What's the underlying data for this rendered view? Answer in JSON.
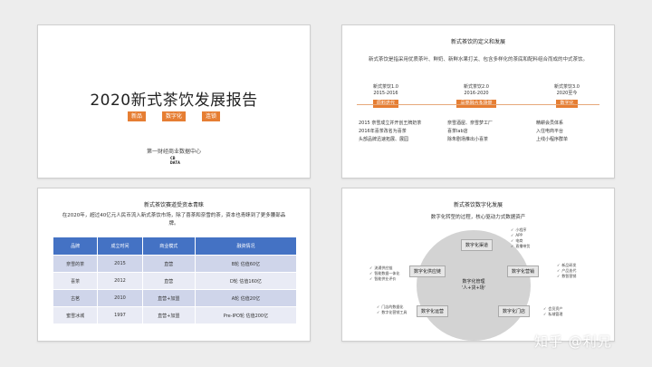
{
  "slide1": {
    "title": "2020新式茶饮发展报告",
    "tags": [
      "新品",
      "数字化",
      "连锁"
    ],
    "subtitle": "第一财经商业数据中心",
    "logo_lines": [
      "CB",
      "DATA"
    ]
  },
  "slide2": {
    "title": "新式茶饮的定义和发展",
    "desc": "新式茶饮是指采用优质茶叶、鲜奶、新鲜水果打关、包含多样化的茶底和配料组合而成的中式茶饮。",
    "versions": [
      {
        "label": "新式茶饮1.0",
        "years": "2015-2016",
        "box": "原料迭代"
      },
      {
        "label": "新式茶饮2.0",
        "years": "2016-2020",
        "box": "品类融合多场景"
      },
      {
        "label": "新式茶饮3.0",
        "years": "2020至今",
        "box": "数字化"
      }
    ],
    "features": [
      [
        "2015 奈雪成立并开创王牌奶茶",
        "2016年喜茶改名为喜茶",
        "头部品牌迅速拓展、展园"
      ],
      [
        "奈雪酒屋、奈雪梦工厂",
        "喜茶lab店",
        "除朱剧场推出小喜茶"
      ],
      [
        "精耕会员体系",
        "入住电商平台",
        "上线小程序群单"
      ]
    ]
  },
  "slide3": {
    "title": "新式茶饮赛道受资本青睐",
    "desc": "在2020年，超过40亿元人民币流入新式茶饮市场，除了喜茶和奈雪的茶，资本也青睐到了更多腰部品牌。",
    "headers": [
      "品牌",
      "成立时间",
      "商业模式",
      "融资情况"
    ],
    "rows": [
      [
        "奈雪的茶",
        "2015",
        "直营",
        "B轮 估值60亿"
      ],
      [
        "喜茶",
        "2012",
        "直营",
        "D轮 估值160亿"
      ],
      [
        "古茗",
        "2010",
        "直营+加盟",
        "A轮 估值20亿"
      ],
      [
        "蜜雪冰城",
        "1997",
        "直营+加盟",
        "Pre-IPO轮 估值200亿"
      ]
    ]
  },
  "slide4": {
    "title": "新式茶饮数字化发展",
    "subtitle": "数字化转型的过程，核心驱动力式数据资产",
    "center": [
      "数字化管理",
      "'人+货+场'"
    ],
    "nodes": {
      "top": "数字化渠道",
      "left": "数字化供应链",
      "right": "数字化营销",
      "bottom_left": "数字化运营",
      "bottom_right": "数字化门店"
    },
    "notes": {
      "top": [
        "小程序",
        "APP",
        "电商",
        "直播带货"
      ],
      "left": [
        "流通供应链",
        "智能数据一体化",
        "智能供业评价"
      ],
      "right": [
        "新品研发",
        "产品迭代",
        "数智营销"
      ],
      "bottom_left": [
        "门店的数据化",
        "数字化营销工具"
      ],
      "bottom_right": [
        "会员资产",
        "私域管理"
      ]
    },
    "check": "✓"
  },
  "watermark": "知乎 @利兄",
  "colors": {
    "accent": "#e67e33",
    "table_header": "#4472c4",
    "table_row_a": "#cfd5ea",
    "table_row_b": "#e9ebf5"
  }
}
